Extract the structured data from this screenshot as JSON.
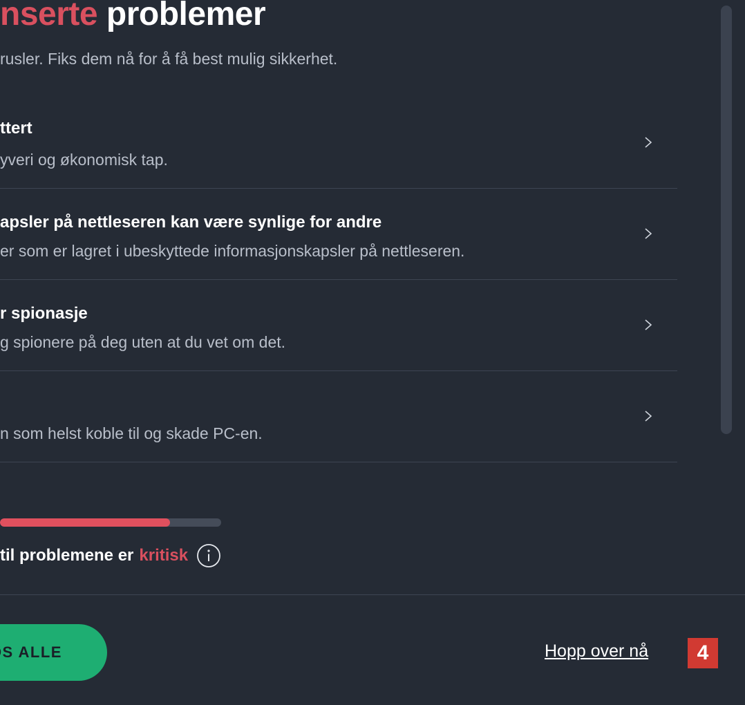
{
  "header": {
    "title_accent": "nserte",
    "title_rest": " problemer",
    "subtitle": "rusler. Fiks dem nå for å få best mulig sikkerhet."
  },
  "issues": [
    {
      "title": "ttert",
      "description": "yveri og økonomisk tap."
    },
    {
      "title": "apsler på nettleseren kan være synlige for andre",
      "description": "er som er lagret i ubeskyttede informasjonskapsler på nettleseren."
    },
    {
      "title": "r spionasje",
      "description": "g spionere på deg uten at du vet om det."
    },
    {
      "title": "",
      "description": "n som helst koble til og skade PC-en."
    }
  ],
  "risk": {
    "progress_fraction": 0.77,
    "label": "til problemene er",
    "level": "kritisk"
  },
  "footer": {
    "fix_all_label": "LØS ALLE",
    "skip_label": "Hopp over nå",
    "badge": "4"
  },
  "icons": {
    "chevron": "chevron-right-icon",
    "info": "info-icon"
  },
  "colors": {
    "accent": "#d9505f",
    "background": "#252b35",
    "button": "#1eae72",
    "badge": "#d13a32"
  }
}
